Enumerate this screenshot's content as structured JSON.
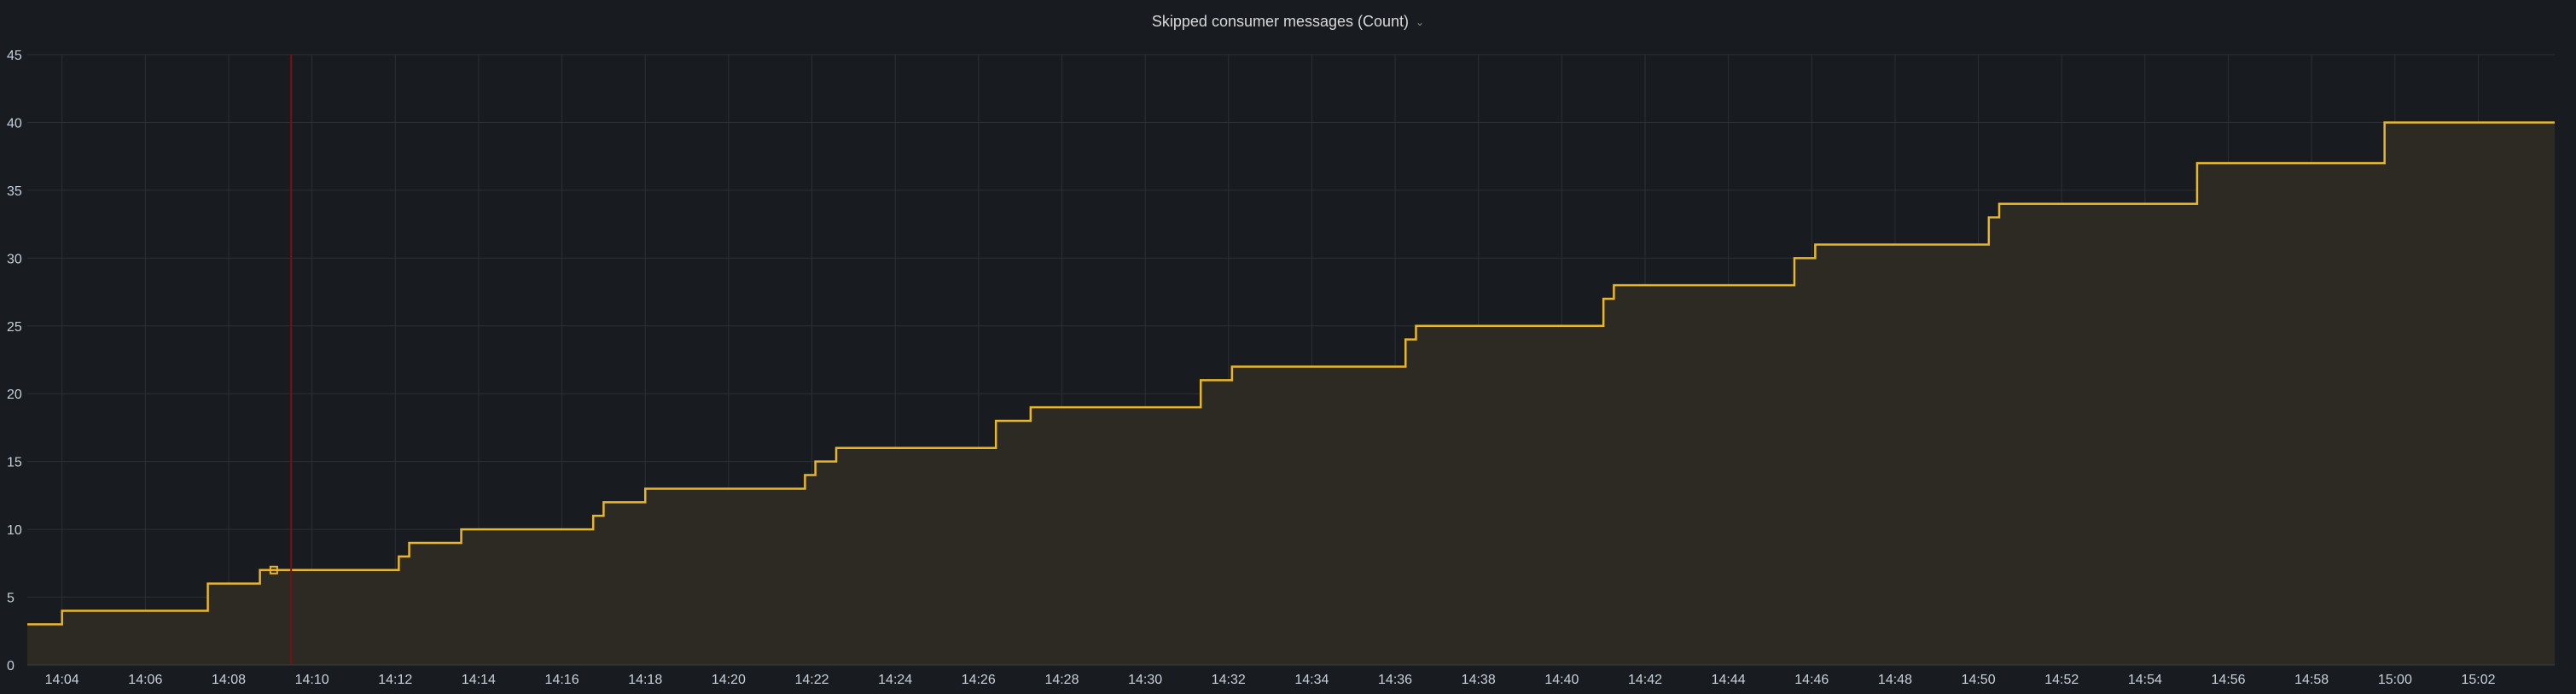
{
  "panel": {
    "title": "Skipped consumer messages (Count)",
    "chevron_icon": "chevron-down-icon"
  },
  "colors": {
    "background": "#181b1f",
    "grid": "#2c3035",
    "line": "#e8b62c",
    "fill": "#2d2a24",
    "cursor": "#7a1010",
    "tick_text": "#c7d0d9"
  },
  "chart_data": {
    "type": "line",
    "title": "Skipped consumer messages (Count)",
    "xlabel": "",
    "ylabel": "",
    "step": true,
    "fill_area": true,
    "grid": true,
    "legend": "none",
    "xlim": [
      "14:03:10",
      "15:03:50"
    ],
    "ylim": [
      0,
      45
    ],
    "yticks": [
      0,
      5,
      10,
      15,
      20,
      25,
      30,
      35,
      40,
      45
    ],
    "xticks": [
      "14:04",
      "14:06",
      "14:08",
      "14:10",
      "14:12",
      "14:14",
      "14:16",
      "14:18",
      "14:20",
      "14:22",
      "14:24",
      "14:26",
      "14:28",
      "14:30",
      "14:32",
      "14:34",
      "14:36",
      "14:38",
      "14:40",
      "14:42",
      "14:44",
      "14:46",
      "14:48",
      "14:50",
      "14:52",
      "14:54",
      "14:56",
      "14:58",
      "15:00",
      "15:02"
    ],
    "cursor_time": "14:09:30",
    "series": [
      {
        "points": [
          [
            "14:03:10",
            3
          ],
          [
            "14:04:00",
            4
          ],
          [
            "14:07:30",
            6
          ],
          [
            "14:08:45",
            7
          ],
          [
            "14:12:05",
            8
          ],
          [
            "14:12:20",
            9
          ],
          [
            "14:13:35",
            10
          ],
          [
            "14:16:45",
            11
          ],
          [
            "14:17:00",
            12
          ],
          [
            "14:18:00",
            13
          ],
          [
            "14:21:50",
            14
          ],
          [
            "14:22:05",
            15
          ],
          [
            "14:22:35",
            16
          ],
          [
            "14:26:25",
            18
          ],
          [
            "14:27:15",
            19
          ],
          [
            "14:31:20",
            21
          ],
          [
            "14:32:05",
            22
          ],
          [
            "14:36:15",
            24
          ],
          [
            "14:36:30",
            25
          ],
          [
            "14:41:00",
            27
          ],
          [
            "14:41:15",
            28
          ],
          [
            "14:45:35",
            30
          ],
          [
            "14:46:05",
            31
          ],
          [
            "14:50:15",
            33
          ],
          [
            "14:50:30",
            34
          ],
          [
            "14:55:15",
            37
          ],
          [
            "14:59:45",
            40
          ],
          [
            "15:03:50",
            40
          ]
        ]
      }
    ]
  }
}
